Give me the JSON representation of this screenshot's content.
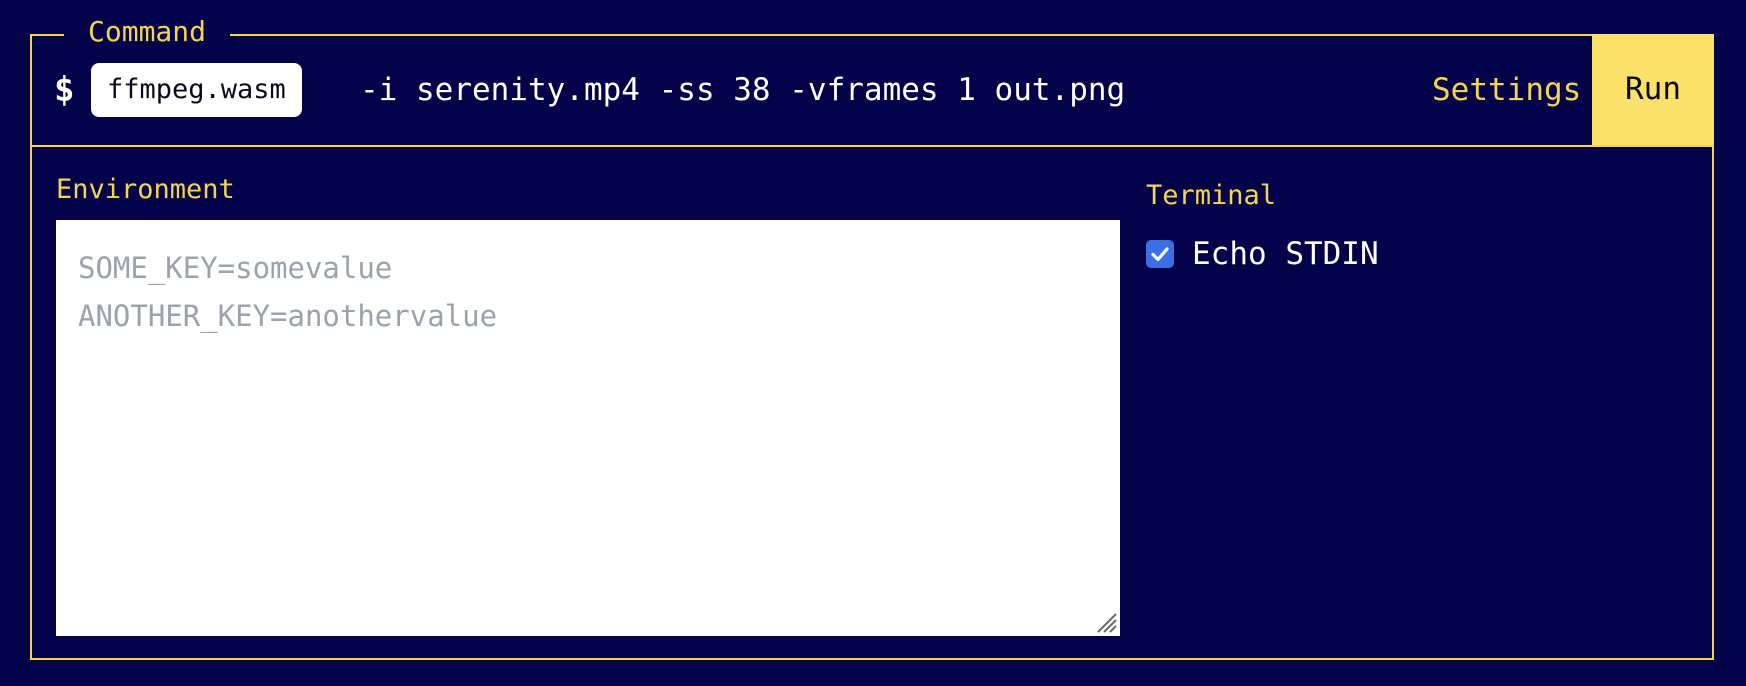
{
  "command": {
    "legend": "Command",
    "prompt": "$",
    "program": "ffmpeg.wasm",
    "args": "-i serenity.mp4 -ss 38 -vframes 1 out.png",
    "settings_label": "Settings",
    "run_label": "Run"
  },
  "environment": {
    "label": "Environment",
    "placeholder": "SOME_KEY=somevalue\nANOTHER_KEY=anothervalue"
  },
  "terminal": {
    "label": "Terminal",
    "echo_stdin_label": "Echo STDIN",
    "echo_stdin_checked": true
  },
  "colors": {
    "background": "#04034a",
    "accent": "#f5d54d",
    "run_button": "#fbe06a",
    "checkbox": "#3a6fe6"
  }
}
